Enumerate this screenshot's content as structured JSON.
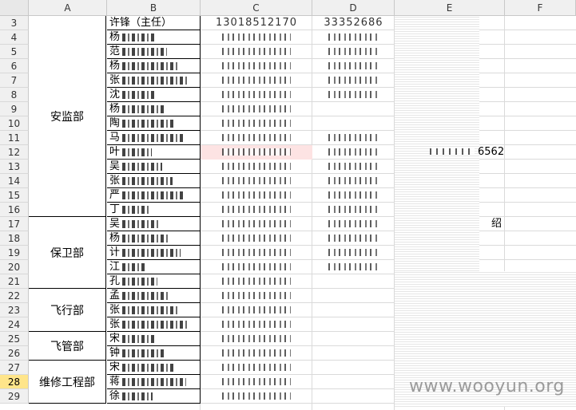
{
  "columns": [
    "A",
    "B",
    "C",
    "D",
    "E",
    "F"
  ],
  "active_row": "28",
  "departments": [
    {
      "name": "安监部"
    },
    {
      "name": "保卫部"
    },
    {
      "name": "飞行部"
    },
    {
      "name": "飞管部"
    },
    {
      "name": "维修工程部"
    }
  ],
  "rows": [
    {
      "row": "3",
      "b": "许锋（主任）",
      "c": "13018512170",
      "d": "33352686"
    },
    {
      "row": "4",
      "b": "杨"
    },
    {
      "row": "5",
      "b": "范"
    },
    {
      "row": "6",
      "b": "杨"
    },
    {
      "row": "7",
      "b": "张"
    },
    {
      "row": "8",
      "b": "沈"
    },
    {
      "row": "9",
      "b": "杨"
    },
    {
      "row": "10",
      "b": "陶"
    },
    {
      "row": "11",
      "b": "马"
    },
    {
      "row": "12",
      "b": "叶"
    },
    {
      "row": "13",
      "b": "吴"
    },
    {
      "row": "14",
      "b": "张"
    },
    {
      "row": "15",
      "b": "严"
    },
    {
      "row": "16",
      "b": "丁"
    },
    {
      "row": "17",
      "b": "吴"
    },
    {
      "row": "18",
      "b": "杨"
    },
    {
      "row": "19",
      "b": "计"
    },
    {
      "row": "20",
      "b": "江"
    },
    {
      "row": "21",
      "b": "孔"
    },
    {
      "row": "22",
      "b": "孟"
    },
    {
      "row": "23",
      "b": "张"
    },
    {
      "row": "24",
      "b": "张"
    },
    {
      "row": "25",
      "b": "宋"
    },
    {
      "row": "26",
      "b": "钟"
    },
    {
      "row": "27",
      "b": "宋"
    },
    {
      "row": "28",
      "b": "蒋"
    },
    {
      "row": "29",
      "b": "徐"
    }
  ],
  "e12_text": "6562",
  "e17_text": "绍",
  "watermark": "www.wooyun.org"
}
